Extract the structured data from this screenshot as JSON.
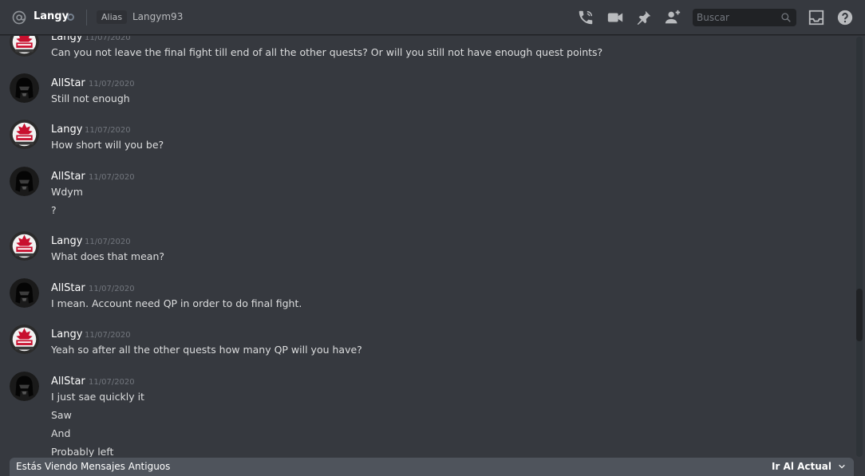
{
  "header": {
    "channel_name": "Langy",
    "alias_label": "Alias",
    "alias_value": "Langym93",
    "search_placeholder": "Buscar",
    "icons": [
      "at-icon",
      "status-offline-icon",
      "call-icon",
      "video-icon",
      "pin-icon",
      "add-member-icon",
      "search-icon",
      "inbox-icon",
      "help-icon"
    ]
  },
  "colors": {
    "background": "#36393f",
    "header_border": "#202225",
    "text": "#dcddde",
    "timestamp": "#72767d",
    "banner": "#4f545c"
  },
  "messages": [
    {
      "author": "Langy",
      "timestamp": "11/07/2020",
      "lines": [
        "Can you not leave the final fight till end of all the other quests? Or will you still not have enough quest points?"
      ]
    },
    {
      "author": "AllStar",
      "timestamp": "11/07/2020",
      "lines": [
        "Still not enough"
      ]
    },
    {
      "author": "Langy",
      "timestamp": "11/07/2020",
      "lines": [
        "How short will you be?"
      ]
    },
    {
      "author": "AllStar",
      "timestamp": "11/07/2020",
      "lines": [
        "Wdym",
        "?"
      ]
    },
    {
      "author": "Langy",
      "timestamp": "11/07/2020",
      "lines": [
        "What does that mean?"
      ]
    },
    {
      "author": "AllStar",
      "timestamp": "11/07/2020",
      "lines": [
        "I mean. Account need QP in order to do final fight."
      ]
    },
    {
      "author": "Langy",
      "timestamp": "11/07/2020",
      "lines": [
        "Yeah so after all the other quests how many QP will you have?"
      ]
    },
    {
      "author": "AllStar",
      "timestamp": "11/07/2020",
      "lines": [
        "I just sae quickly it",
        "Saw",
        "And",
        "Probably left"
      ]
    }
  ],
  "banner": {
    "text": "Estás Viendo Mensajes Antiguos",
    "jump_label": "Ir Al Actual"
  }
}
